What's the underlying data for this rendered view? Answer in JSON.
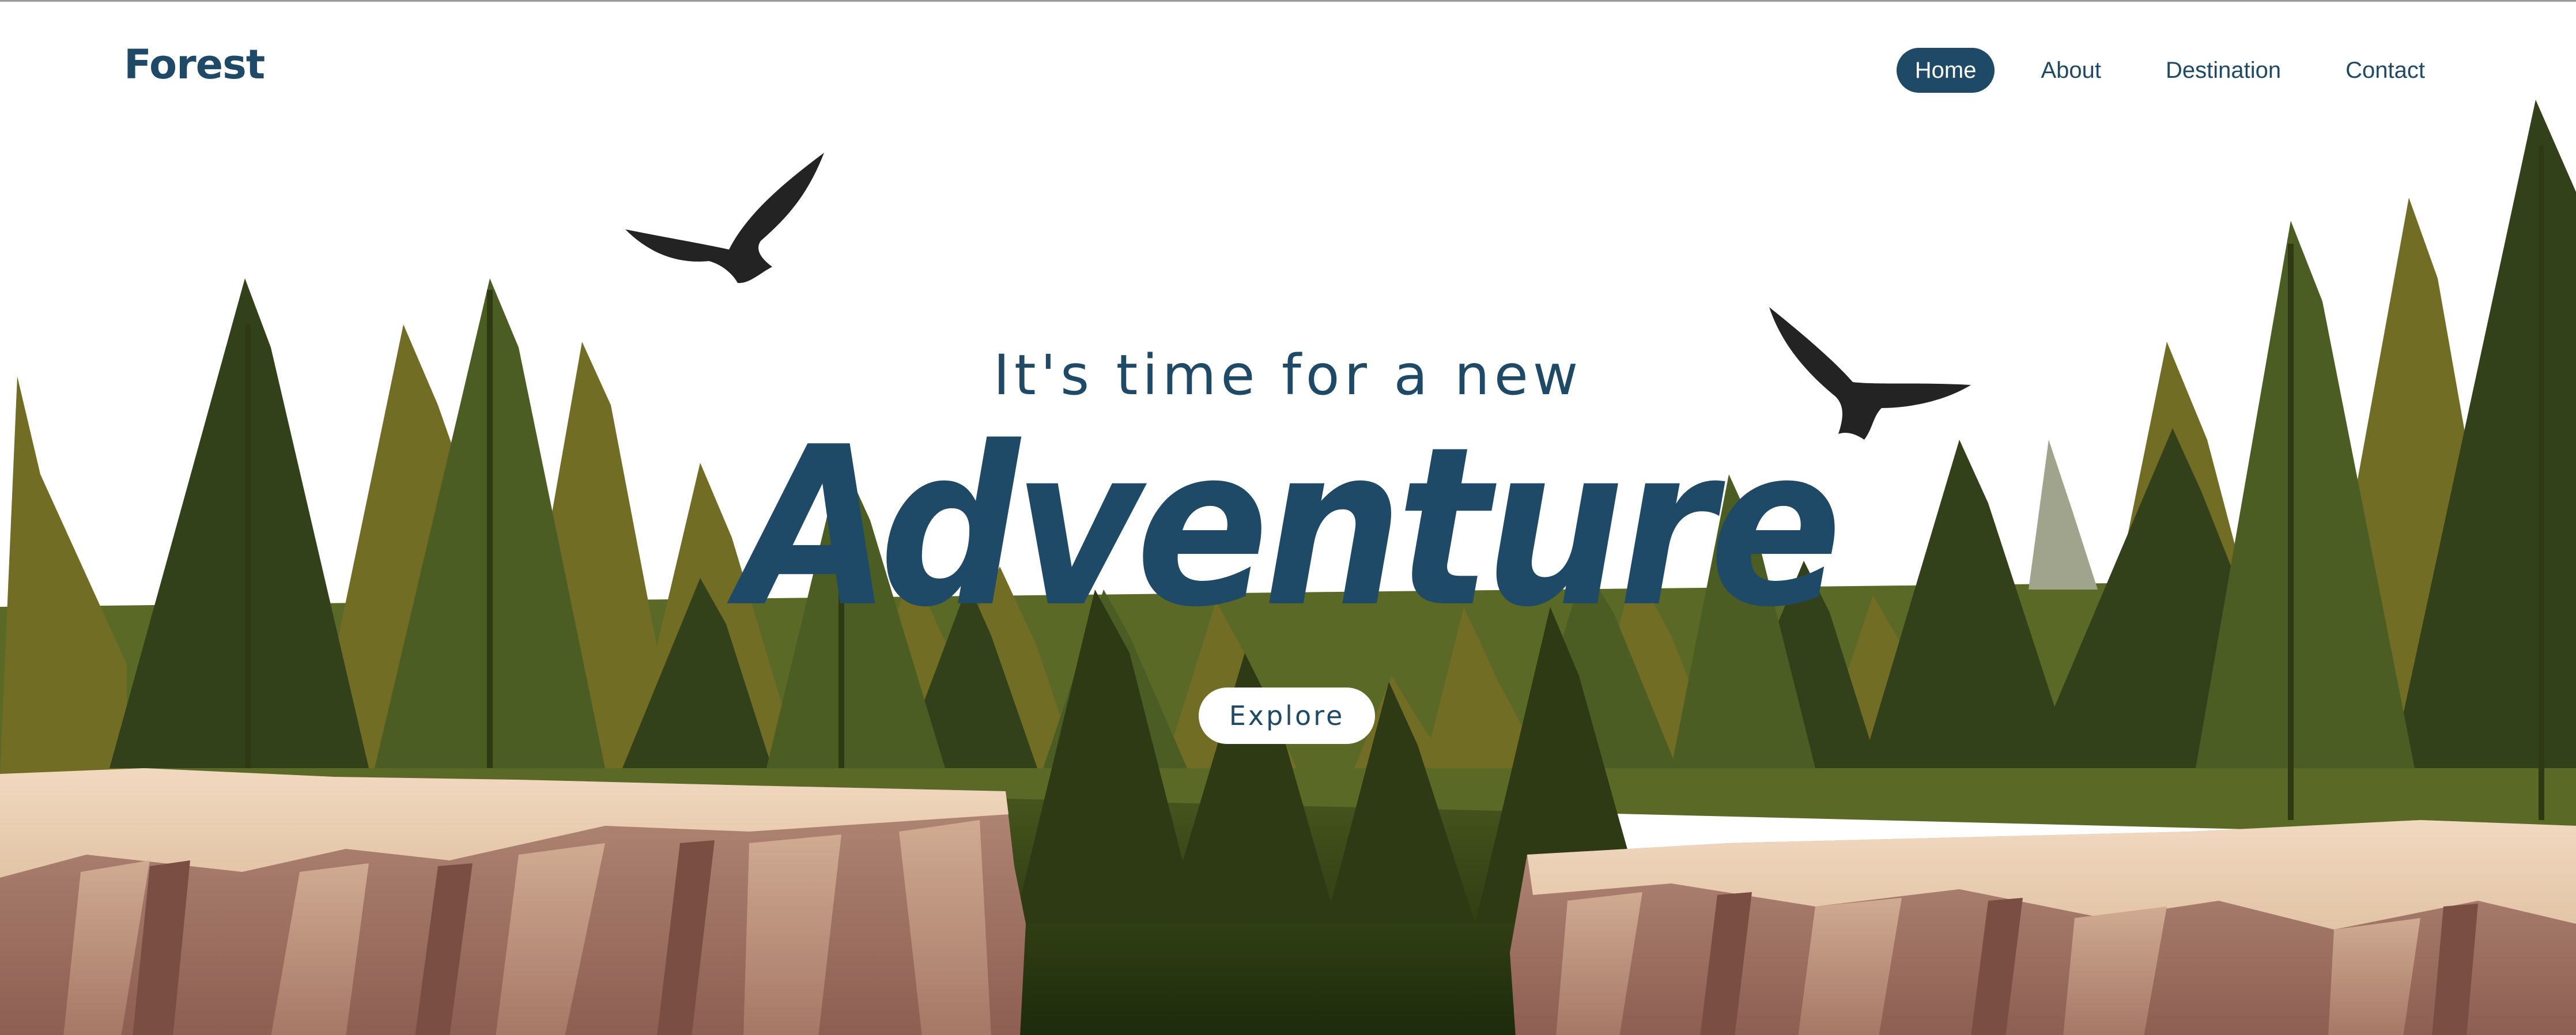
{
  "brand": {
    "logo": "Forest"
  },
  "nav": {
    "items": [
      {
        "label": "Home",
        "active": true
      },
      {
        "label": "About",
        "active": false
      },
      {
        "label": "Destination",
        "active": false
      },
      {
        "label": "Contact",
        "active": false
      }
    ]
  },
  "hero": {
    "subtitle": "It's time for a new",
    "title": "Adventure",
    "cta_label": "Explore"
  },
  "colors": {
    "brand": "#1f4a67",
    "background": "#ffffff",
    "tree_dark": "#2f3a14",
    "tree_olive": "#6e6a22",
    "tree_green": "#4c5e22",
    "cliff_top": "#e8cdb2",
    "cliff_face": "#a7786a",
    "bird": "#232323"
  },
  "icons": [
    "eagle-icon",
    "eagle-icon"
  ]
}
